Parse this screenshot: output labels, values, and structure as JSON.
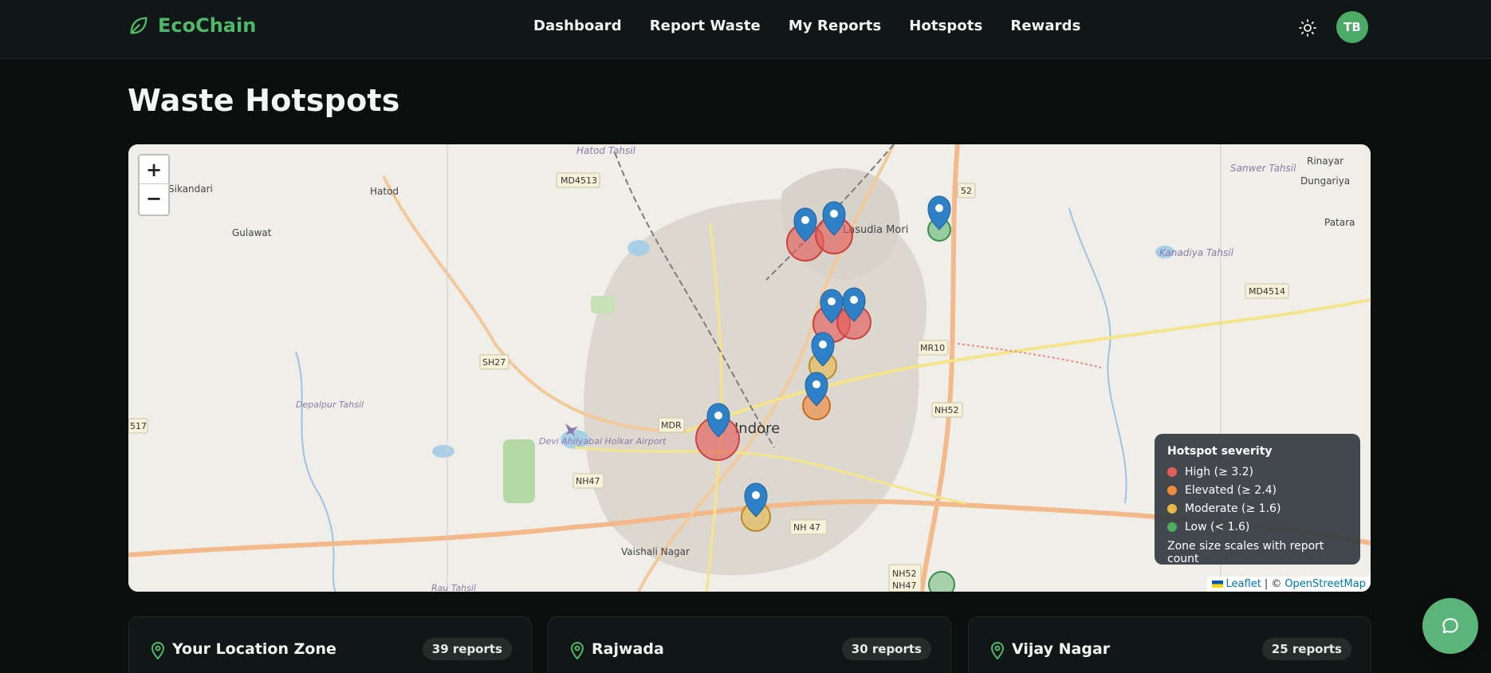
{
  "app": {
    "name": "EcoChain"
  },
  "nav": {
    "items": [
      "Dashboard",
      "Report Waste",
      "My Reports",
      "Hotspots",
      "Rewards"
    ]
  },
  "user": {
    "initials": "TB"
  },
  "page": {
    "title": "Waste Hotspots"
  },
  "map": {
    "zoom_in": "+",
    "zoom_out": "−",
    "labels": {
      "sikandari": "Sikandari",
      "hatod": "Hatod",
      "gulawat": "Gulawat",
      "hatod_tahsil": "Hatod Tahsil",
      "sanwer_tahsil": "Sanwer Tahsil",
      "rinayar": "Rinayar",
      "dungariya": "Dungariya",
      "patara": "Patara",
      "lasudia_mori": "Lasudia Mori",
      "kanadiya_tahsil": "Kanadiya Tahsil",
      "indore": "Indore",
      "airport": "Devi Ahilyabai Holkar Airport",
      "vaishali_nagar": "Vaishali Nagar",
      "depalpur_tahsil": "Depalpur Tahsil",
      "rau_tahsil": "Rau Tahsil"
    },
    "road_shields": [
      "MD4513",
      "SH27",
      "MDR",
      "NH47",
      "MR10",
      "NH52",
      "NH 47",
      "MD4514",
      "NH52",
      "NH47",
      "52",
      "517"
    ],
    "attribution": {
      "leaflet": "Leaflet",
      "separator": "| ©",
      "osm": "OpenStreetMap"
    }
  },
  "legend": {
    "title": "Hotspot severity",
    "items": [
      {
        "label": "High (≥ 3.2)",
        "color": "#e35d5b"
      },
      {
        "label": "Elevated (≥ 2.4)",
        "color": "#f08a3c"
      },
      {
        "label": "Moderate (≥ 1.6)",
        "color": "#e8b844"
      },
      {
        "label": "Low (< 1.6)",
        "color": "#4cae5f"
      }
    ],
    "note": "Zone size scales with report count"
  },
  "zones": [
    {
      "name": "Your Location Zone",
      "reports": "39 reports"
    },
    {
      "name": "Rajwada",
      "reports": "30 reports"
    },
    {
      "name": "Vijay Nagar",
      "reports": "25 reports"
    }
  ],
  "colors": {
    "accent": "#4fb86a",
    "background": "#0b0f0e",
    "marker": "#2f81c7"
  }
}
